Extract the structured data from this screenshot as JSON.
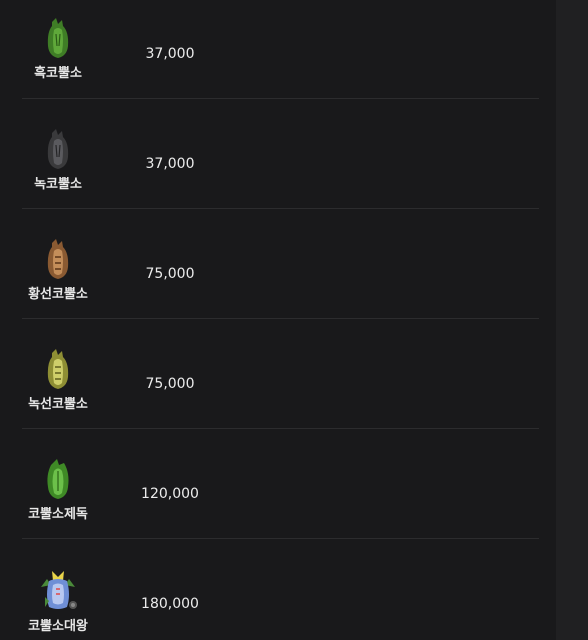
{
  "monsters": [
    {
      "name": "흑코뿔소",
      "price": "37,000",
      "color": "#4a8a2c",
      "dark": "#2a5a16",
      "icon": "rhino-green-icon"
    },
    {
      "name": "녹코뿔소",
      "price": "37,000",
      "color": "#4a4a4c",
      "dark": "#2a2a2c",
      "icon": "rhino-gray-icon"
    },
    {
      "name": "황선코뿔소",
      "price": "75,000",
      "color": "#b07a4a",
      "dark": "#6a4424",
      "icon": "rhino-brown-icon"
    },
    {
      "name": "녹선코뿔소",
      "price": "75,000",
      "color": "#b4b450",
      "dark": "#6e6e24",
      "icon": "rhino-yellow-icon"
    },
    {
      "name": "코뿔소제독",
      "price": "120,000",
      "color": "#56a83a",
      "dark": "#2c6a1c",
      "icon": "rhino-admiral-icon"
    },
    {
      "name": "코뿔소대왕",
      "price": "180,000",
      "color": "#6f8fd6",
      "dark": "#3c5a9a",
      "icon": "rhino-king-icon"
    }
  ]
}
